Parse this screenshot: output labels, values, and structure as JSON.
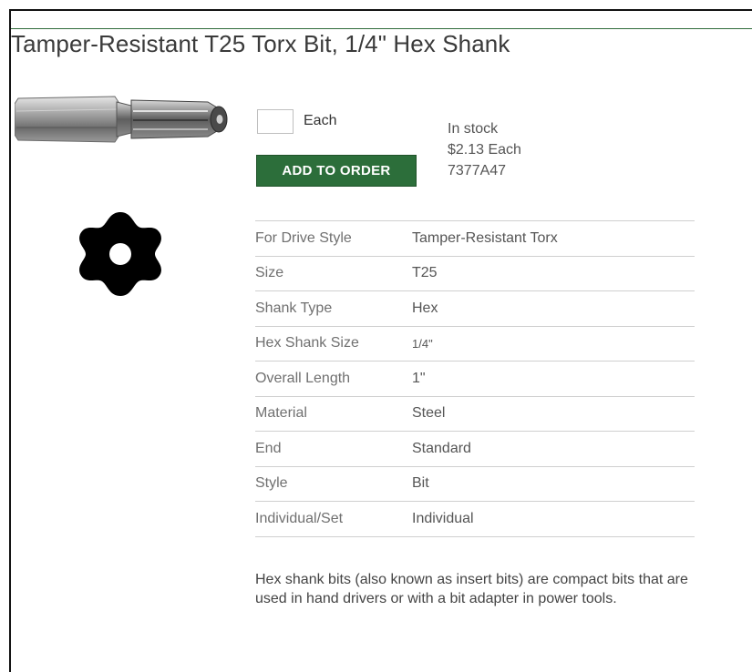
{
  "product": {
    "title": "Tamper-Resistant T25 Torx Bit, 1/4\" Hex Shank",
    "image_icon": "torx-bit-image",
    "drive_icon": "tamper-resistant-torx-drive-icon"
  },
  "order": {
    "quantity_value": "",
    "unit_label": "Each",
    "add_button_label": "ADD TO ORDER",
    "stock_status": "In stock",
    "price": "$2.13 Each",
    "part_number": "7377A47"
  },
  "specs": [
    {
      "label": "For Drive Style",
      "value": "Tamper-Resistant Torx"
    },
    {
      "label": "Size",
      "value": "T25"
    },
    {
      "label": "Shank Type",
      "value": "Hex"
    },
    {
      "label": "Hex Shank Size",
      "value": "1/4\""
    },
    {
      "label": "Overall Length",
      "value": "1\""
    },
    {
      "label": "Material",
      "value": "Steel"
    },
    {
      "label": "End",
      "value": "Standard"
    },
    {
      "label": "Style",
      "value": "Bit"
    },
    {
      "label": "Individual/Set",
      "value": "Individual"
    }
  ],
  "description": "Hex shank bits (also known as insert bits) are compact bits that are used in hand drivers or with a bit adapter in power tools.",
  "colors": {
    "accent_green": "#2c6e3a",
    "title_rule": "#2f6b3a"
  }
}
